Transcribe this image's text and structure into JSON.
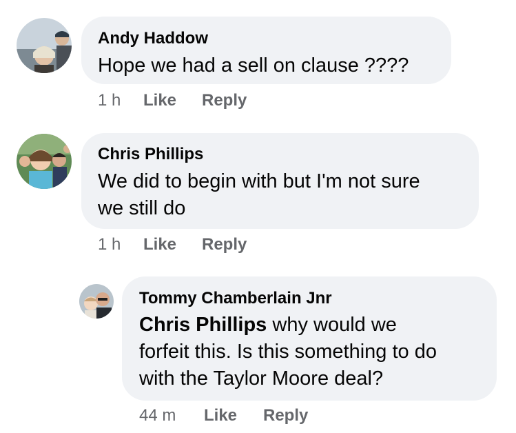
{
  "comments": [
    {
      "author": "Andy Haddow",
      "text_lines": [
        "Hope we had a sell on clause ????"
      ],
      "time": "1 h",
      "like_label": "Like",
      "reply_label": "Reply",
      "avatar_icon": "profile-photo-couple"
    },
    {
      "author": "Chris Phillips",
      "text_lines": [
        "We did to begin with but I'm not sure",
        "we still do"
      ],
      "time": "1 h",
      "like_label": "Like",
      "reply_label": "Reply",
      "avatar_icon": "profile-photo-family"
    },
    {
      "author": "Tommy Chamberlain Jnr",
      "mention": "Chris Phillips",
      "text_line1_rest": " why would we",
      "text_lines_rest": [
        "forfeit this. Is this something to do",
        "with the Taylor Moore deal?"
      ],
      "time": "44 m",
      "like_label": "Like",
      "reply_label": "Reply",
      "avatar_icon": "profile-photo-man-child"
    }
  ],
  "colors": {
    "bubble": "#f0f2f5",
    "text": "#050505",
    "meta": "#65676b"
  }
}
